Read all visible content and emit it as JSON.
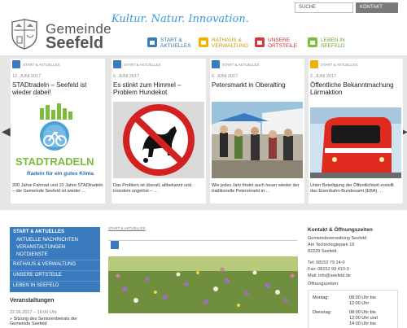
{
  "header": {
    "brand_line1": "Gemeinde",
    "brand_line2": "Seefeld",
    "slogan": "Kultur. Natur. Innovation.",
    "search_label": "SUCHE",
    "contact_label": "KONTAKT"
  },
  "nav": [
    {
      "line1": "START &",
      "line2": "AKTUELLES"
    },
    {
      "line1": "RATHAUS &",
      "line2": "VERWALTUNG"
    },
    {
      "line1": "UNSERE",
      "line2": "ORTSTEILE"
    },
    {
      "line1": "LEBEN IN",
      "line2": "SEEFELD"
    }
  ],
  "cards": [
    {
      "cat": "START & AKTUELLES",
      "date": "12. JUNI 2017",
      "title": "STADtradeln – Seefeld ist wieder dabei!",
      "text": "200 Jahre Fahrrad und 10 Jahre STADtradeln – die Gemeinde Seefeld ist wieder …",
      "logo_top": "STADTRADELN",
      "logo_bottom": "Radeln für ein gutes Klima"
    },
    {
      "cat": "START & AKTUELLES",
      "date": "6. JUNI 2017",
      "title": "Es stinkt zum Himmel – Problem Hundekot",
      "text": "Das Problem ist überall, altbekannt und trotzdem ungelöst – …"
    },
    {
      "cat": "START & AKTUELLES",
      "date": "6. JUNI 2017",
      "title": "Petersmarkt in Oberalting",
      "text": "Wie jedes Jahr findet auch heuer wieder der traditionelle Petersmarkt in …"
    },
    {
      "cat": "START & AKTUELLES",
      "date": "2. JUNI 2017",
      "title": "Öffentliche Bekanntmachung Lärmaktion",
      "text": "Unter Beteiligung der Öffentlichkeit erstellt das Eisenbahn-Bundesamt (EBA) …"
    }
  ],
  "menu": {
    "items": [
      "START & AKTUELLES",
      "AKTUELLE NACHRICHTEN",
      "VERANSTALTUNGEN",
      "NOTDIENSTE",
      "RATHAUS & VERWALTUNG",
      "UNSERE ORTSTEILE",
      "LEBEN IN SEEFELD"
    ]
  },
  "events": {
    "heading": "Veranstaltungen",
    "date": "22.06.2017 – 16:00 Uhr",
    "line1": "» Sitzung des Seniorenbeirats der",
    "line2": "Gemeinde Seefeld"
  },
  "main": {
    "breadcrumb": "START & AKTUELLES"
  },
  "contact": {
    "heading": "Kontakt & Öffnungszeiten",
    "address": [
      "Gemeindeverwaltung Seefeld",
      "Am Technologiepark 16",
      "82229 Seefeld"
    ],
    "tel": "Tel: 08152 79 14-0",
    "fax": "Fax: 08152 99 410-0",
    "mail": "Mail: info@seefeld.de",
    "hours_label": "Öffnungszeiten:",
    "hours": [
      {
        "day": "Montag:",
        "time1": "08:00 Uhr bis",
        "time2": "12:00 Uhr"
      },
      {
        "day": "Dienstag:",
        "time1": "08:00 Uhr bis",
        "time2": "12:00 Uhr und",
        "time3": "14:00 Uhr bis"
      }
    ]
  },
  "colors": {
    "blue": "#3a7bbf",
    "yellow": "#f0b200",
    "red": "#d23b3b",
    "green": "#7cbc3b"
  }
}
